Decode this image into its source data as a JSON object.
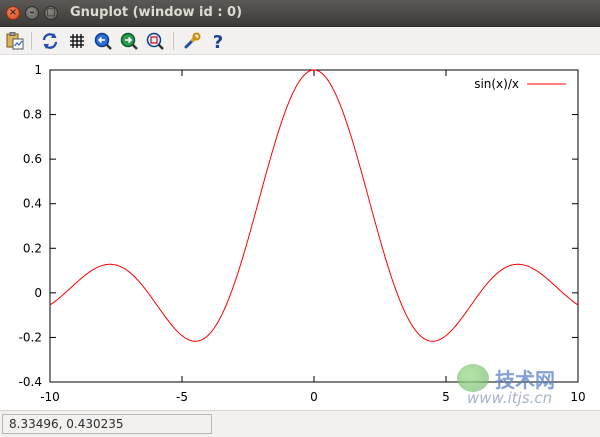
{
  "window": {
    "title": "Gnuplot (window id : 0)",
    "controls": [
      "close",
      "minimize",
      "maximize"
    ]
  },
  "toolbar": {
    "items": [
      {
        "name": "copy-to-clipboard-icon"
      },
      {
        "name": "replot-icon"
      },
      {
        "name": "grid-icon"
      },
      {
        "name": "previous-zoom-icon"
      },
      {
        "name": "next-zoom-icon"
      },
      {
        "name": "autoscale-icon"
      },
      {
        "name": "settings-wrench-icon"
      },
      {
        "name": "help-icon"
      }
    ]
  },
  "chart_data": {
    "type": "line",
    "function": "sin(x)/x",
    "xlim": [
      -10,
      10
    ],
    "ylim": [
      -0.4,
      1
    ],
    "x_ticks": [
      -10,
      -5,
      0,
      5,
      10
    ],
    "y_ticks": [
      -0.4,
      -0.2,
      0,
      0.2,
      0.4,
      0.6,
      0.8,
      1
    ],
    "x_tick_labels": [
      "-10",
      "-5",
      "0",
      "5",
      "10"
    ],
    "y_tick_labels": [
      "-0.4",
      "-0.2",
      "0",
      "0.2",
      "0.4",
      "0.6",
      "0.8",
      "1"
    ],
    "grid": false,
    "legend_position": "top-right",
    "series": [
      {
        "name": "sin(x)/x",
        "color": "#ff0000"
      }
    ]
  },
  "statusbar": {
    "coordinates": "8.33496,  0.430235"
  },
  "watermark": {
    "brand": "技术网",
    "url": "www.itjs.cn"
  }
}
